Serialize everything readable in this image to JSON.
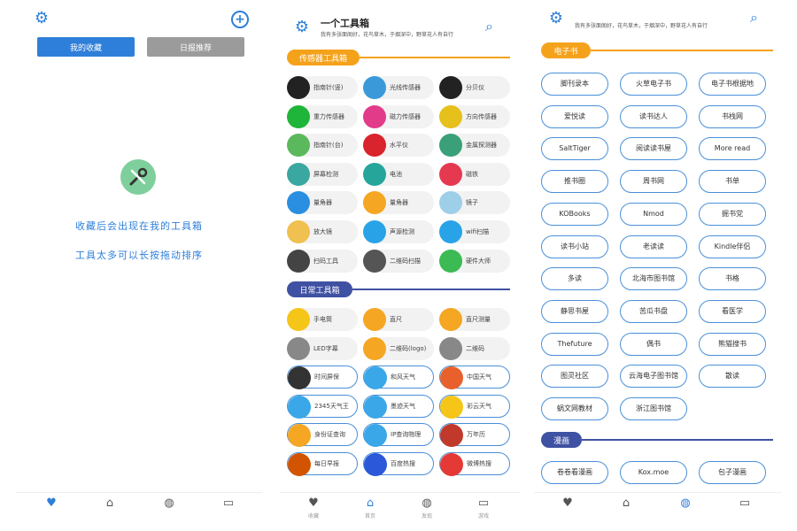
{
  "colors": {
    "blue": "#2e7fd9",
    "orange": "#f5a21b",
    "navy": "#3f51a3",
    "grey": "#9b9b9b"
  },
  "p1": {
    "tab_mine": "我的收藏",
    "tab_recent": "日报推荐",
    "empty_line1": "收藏后会出现在我的工具箱",
    "empty_line2": "工具太多可以长按拖动排序",
    "nav": {
      "fav_icon": "heart-icon",
      "home_icon": "home-icon",
      "explore_icon": "globe-icon",
      "game_icon": "gamepad-icon"
    }
  },
  "p2": {
    "title": "一个工具箱",
    "subtitle": "我有多张面阁好，花鸟草木，于烟深中，野草花人有自行",
    "sec1": "传感器工具箱",
    "sec2": "日常工具箱",
    "tools1": [
      "指南针(竖)",
      "光线传感器",
      "分贝仪",
      "重力传感器",
      "磁力传感器",
      "方向传感器",
      "指南针(台)",
      "水平仪",
      "金属探测器",
      "屏幕检测",
      "电池",
      "磁铁",
      "量角器",
      "量角器",
      "镜子",
      "放大镜",
      "声源检测",
      "wifi扫描",
      "扫码工具",
      "二维码扫描",
      "硬件大师"
    ],
    "tools2": [
      "手电筒",
      "直尺",
      "直尺测量",
      "LED字幕",
      "二维码(logo)",
      "二维码",
      "时间屏保",
      "和风天气",
      "中国天气",
      "2345天气王",
      "墨迹天气",
      "彩云天气",
      "身份证查询",
      "IP查询物理",
      "万年历",
      "每日早报",
      "百度热搜",
      "微博热搜"
    ],
    "nav": [
      "收藏",
      "首页",
      "发现",
      "游戏"
    ]
  },
  "p3": {
    "subtitle": "我有多张面阁好，花鸟草木，于烟深中，野草花人有自行",
    "sec1": "电子书",
    "sec2": "漫画",
    "books": [
      "脚刊录本",
      "火草电子书",
      "电子书根据地",
      "爱悦读",
      "读书达人",
      "书栈网",
      "SaltTiger",
      "阅读读书屋",
      "More read",
      "推书圈",
      "周书网",
      "书单",
      "KOBooks",
      "Nmod",
      "掘书党",
      "读书小站",
      "老读读",
      "Kindle伴侣",
      "多读",
      "北海市图书馆",
      "书格",
      "静思书屋",
      "苦瓜书盘",
      "看医学",
      "Thefuture",
      "偶书",
      "熊猫搜书",
      "图灵社区",
      "云海电子图书馆",
      "散读",
      "蜗文网教材",
      "浙江图书馆"
    ],
    "comics": [
      "卷卷看漫画",
      "Kox.moe",
      "包子漫画"
    ]
  }
}
